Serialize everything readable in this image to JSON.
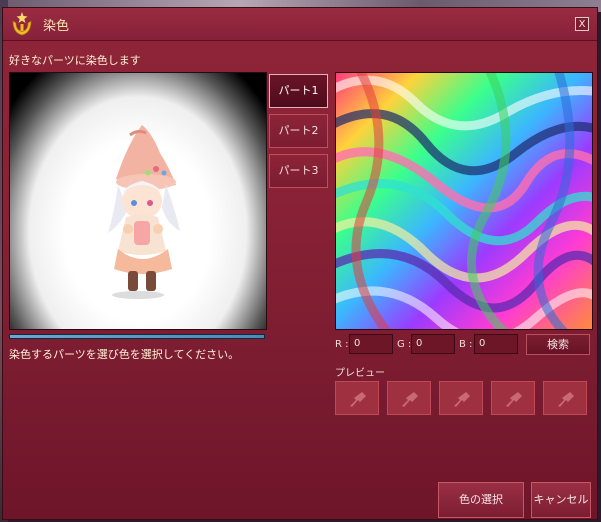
{
  "window": {
    "title": "染色",
    "close_label": "X",
    "instruction": "好きなパーツに染色します",
    "hint": "染色するパーツを選び色を選択してください。"
  },
  "preview_progress": 1.0,
  "parts": [
    {
      "label": "パート1",
      "active": true
    },
    {
      "label": "パート2",
      "active": false
    },
    {
      "label": "パート3",
      "active": false
    }
  ],
  "rgb": {
    "r_label": "R :",
    "r_value": "0",
    "g_label": "G :",
    "g_value": "0",
    "b_label": "B :",
    "b_value": "0"
  },
  "search_label": "検索",
  "preview_slots_label": "プレビュー",
  "preview_slots": [
    {
      "icon": "bolt-icon"
    },
    {
      "icon": "bolt-icon"
    },
    {
      "icon": "bolt-icon"
    },
    {
      "icon": "bolt-icon"
    },
    {
      "icon": "bolt-icon"
    }
  ],
  "footer": {
    "select_color_label": "色の選択",
    "cancel_label": "キャンセル"
  },
  "colors": {
    "window_bg": "#8a2236",
    "title_text": "#f5e7b0",
    "progress": "#4a8ab7"
  }
}
